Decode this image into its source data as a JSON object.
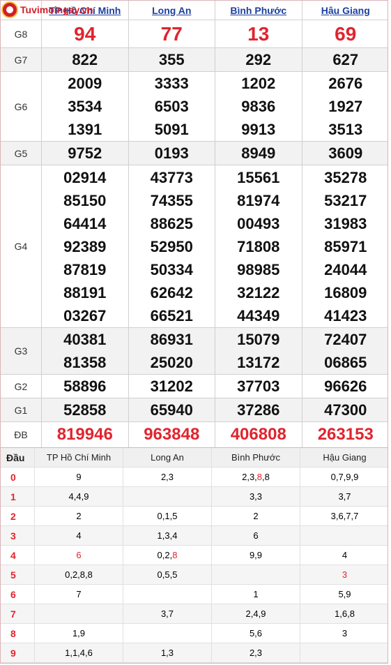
{
  "site": {
    "logo_text": "Tuvimoingay.vn"
  },
  "provinces": [
    "TP Hồ Chí Minh",
    "Long An",
    "Bình Phước",
    "Hậu Giang"
  ],
  "prizes": [
    {
      "label": "G8",
      "style": "big",
      "shade": false,
      "values": [
        [
          "94"
        ],
        [
          "77"
        ],
        [
          "13"
        ],
        [
          "69"
        ]
      ]
    },
    {
      "label": "G7",
      "style": "",
      "shade": true,
      "values": [
        [
          "822"
        ],
        [
          "355"
        ],
        [
          "292"
        ],
        [
          "627"
        ]
      ]
    },
    {
      "label": "G6",
      "style": "",
      "shade": false,
      "values": [
        [
          "2009",
          "3534",
          "1391"
        ],
        [
          "3333",
          "6503",
          "5091"
        ],
        [
          "1202",
          "9836",
          "9913"
        ],
        [
          "2676",
          "1927",
          "3513"
        ]
      ]
    },
    {
      "label": "G5",
      "style": "",
      "shade": true,
      "values": [
        [
          "9752"
        ],
        [
          "0193"
        ],
        [
          "8949"
        ],
        [
          "3609"
        ]
      ]
    },
    {
      "label": "G4",
      "style": "",
      "shade": false,
      "values": [
        [
          "02914",
          "85150",
          "64414",
          "92389",
          "87819",
          "88191",
          "03267"
        ],
        [
          "43773",
          "74355",
          "88625",
          "52950",
          "50334",
          "62642",
          "66521"
        ],
        [
          "15561",
          "81974",
          "00493",
          "71808",
          "98985",
          "32122",
          "44349"
        ],
        [
          "35278",
          "53217",
          "31983",
          "85971",
          "24044",
          "16809",
          "41423"
        ]
      ]
    },
    {
      "label": "G3",
      "style": "",
      "shade": true,
      "values": [
        [
          "40381",
          "81358"
        ],
        [
          "86931",
          "25020"
        ],
        [
          "15079",
          "13172"
        ],
        [
          "72407",
          "06865"
        ]
      ]
    },
    {
      "label": "G2",
      "style": "",
      "shade": false,
      "values": [
        [
          "58896"
        ],
        [
          "31202"
        ],
        [
          "37703"
        ],
        [
          "96626"
        ]
      ]
    },
    {
      "label": "G1",
      "style": "",
      "shade": true,
      "values": [
        [
          "52858"
        ],
        [
          "65940"
        ],
        [
          "37286"
        ],
        [
          "47300"
        ]
      ]
    },
    {
      "label": "ĐB",
      "style": "red",
      "shade": false,
      "values": [
        [
          "819946"
        ],
        [
          "963848"
        ],
        [
          "406808"
        ],
        [
          "263153"
        ]
      ]
    }
  ],
  "loto": {
    "head_label": "Đầu",
    "columns": [
      "TP Hồ Chí Minh",
      "Long An",
      "Bình Phước",
      "Hậu Giang"
    ],
    "rows": [
      {
        "dau": "0",
        "cells": [
          [
            [
              "9",
              0
            ]
          ],
          [
            [
              "2,3",
              0
            ]
          ],
          [
            [
              "2,3,",
              0
            ],
            [
              "8",
              1
            ],
            [
              ",8",
              0
            ]
          ],
          [
            [
              "0,7,9,9",
              0
            ]
          ]
        ]
      },
      {
        "dau": "1",
        "cells": [
          [
            [
              "4,4,9",
              0
            ]
          ],
          [],
          [
            [
              "3,3",
              0
            ]
          ],
          [
            [
              "3,7",
              0
            ]
          ]
        ]
      },
      {
        "dau": "2",
        "cells": [
          [
            [
              "2",
              0
            ]
          ],
          [
            [
              "0,1,5",
              0
            ]
          ],
          [
            [
              "2",
              0
            ]
          ],
          [
            [
              "3,6,7,7",
              0
            ]
          ]
        ]
      },
      {
        "dau": "3",
        "cells": [
          [
            [
              "4",
              0
            ]
          ],
          [
            [
              "1,3,4",
              0
            ]
          ],
          [
            [
              "6",
              0
            ]
          ],
          []
        ]
      },
      {
        "dau": "4",
        "cells": [
          [
            [
              "6",
              1
            ]
          ],
          [
            [
              "0,2,",
              0
            ],
            [
              "8",
              1
            ]
          ],
          [
            [
              "9,9",
              0
            ]
          ],
          [
            [
              "4",
              0
            ]
          ]
        ]
      },
      {
        "dau": "5",
        "cells": [
          [
            [
              "0,2,8,8",
              0
            ]
          ],
          [
            [
              "0,5,5",
              0
            ]
          ],
          [],
          [
            [
              "3",
              1
            ]
          ]
        ]
      },
      {
        "dau": "6",
        "cells": [
          [
            [
              "7",
              0
            ]
          ],
          [],
          [
            [
              "1",
              0
            ]
          ],
          [
            [
              "5,9",
              0
            ]
          ]
        ]
      },
      {
        "dau": "7",
        "cells": [
          [],
          [
            [
              "3,7",
              0
            ]
          ],
          [
            [
              "2,4,9",
              0
            ]
          ],
          [
            [
              "1,6,8",
              0
            ]
          ]
        ]
      },
      {
        "dau": "8",
        "cells": [
          [
            [
              "1,9",
              0
            ]
          ],
          [],
          [
            [
              "5,6",
              0
            ]
          ],
          [
            [
              "3",
              0
            ]
          ]
        ]
      },
      {
        "dau": "9",
        "cells": [
          [
            [
              "1,1,4,6",
              0
            ]
          ],
          [
            [
              "1,3",
              0
            ]
          ],
          [
            [
              "2,3",
              0
            ]
          ],
          []
        ]
      }
    ]
  }
}
